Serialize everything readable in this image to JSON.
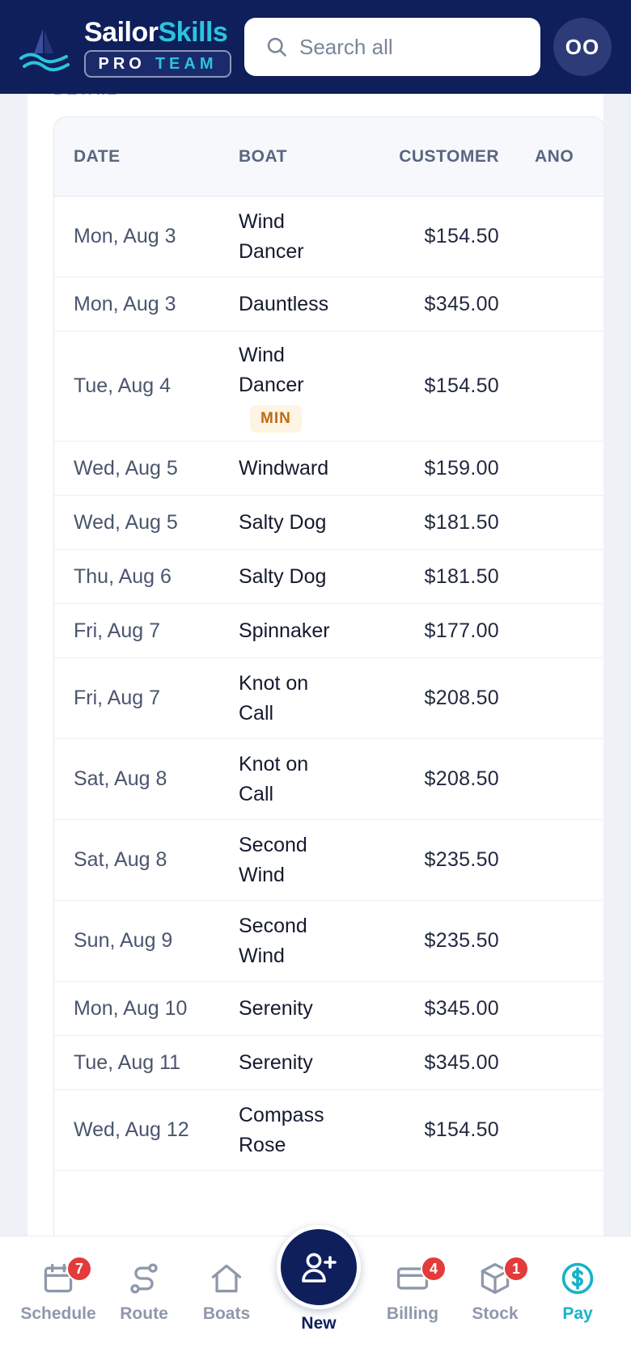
{
  "app": {
    "brand_primary": "Sailor",
    "brand_secondary": "Skills",
    "badge_primary": "PRO",
    "badge_secondary": "TEAM",
    "search_placeholder": "Search all",
    "avatar_initials": "OO"
  },
  "section": {
    "label": "DETAIL"
  },
  "table": {
    "columns": [
      "DATE",
      "BOAT",
      "CUSTOMER",
      "ANO"
    ],
    "rows": [
      {
        "date": "Mon, Aug 3",
        "boat_lines": [
          "Wind",
          "Dancer"
        ],
        "amount": "$154.50",
        "badge": ""
      },
      {
        "date": "Mon, Aug 3",
        "boat_lines": [
          "Dauntless"
        ],
        "amount": "$345.00",
        "badge": ""
      },
      {
        "date": "Tue, Aug 4",
        "boat_lines": [
          "Wind",
          "Dancer"
        ],
        "amount": "$154.50",
        "badge": "MIN"
      },
      {
        "date": "Wed, Aug 5",
        "boat_lines": [
          "Windward"
        ],
        "amount": "$159.00",
        "badge": ""
      },
      {
        "date": "Wed, Aug 5",
        "boat_lines": [
          "Salty Dog"
        ],
        "amount": "$181.50",
        "badge": ""
      },
      {
        "date": "Thu, Aug 6",
        "boat_lines": [
          "Salty Dog"
        ],
        "amount": "$181.50",
        "badge": ""
      },
      {
        "date": "Fri, Aug 7",
        "boat_lines": [
          "Spinnaker"
        ],
        "amount": "$177.00",
        "badge": ""
      },
      {
        "date": "Fri, Aug 7",
        "boat_lines": [
          "Knot on",
          "Call"
        ],
        "amount": "$208.50",
        "badge": ""
      },
      {
        "date": "Sat, Aug 8",
        "boat_lines": [
          "Knot on",
          "Call"
        ],
        "amount": "$208.50",
        "badge": ""
      },
      {
        "date": "Sat, Aug 8",
        "boat_lines": [
          "Second",
          "Wind"
        ],
        "amount": "$235.50",
        "badge": ""
      },
      {
        "date": "Sun, Aug 9",
        "boat_lines": [
          "Second",
          "Wind"
        ],
        "amount": "$235.50",
        "badge": ""
      },
      {
        "date": "Mon, Aug 10",
        "boat_lines": [
          "Serenity"
        ],
        "amount": "$345.00",
        "badge": ""
      },
      {
        "date": "Tue, Aug 11",
        "boat_lines": [
          "Serenity"
        ],
        "amount": "$345.00",
        "badge": ""
      },
      {
        "date": "Wed, Aug 12",
        "boat_lines": [
          "Compass",
          "Rose"
        ],
        "amount": "$154.50",
        "badge": ""
      }
    ]
  },
  "nav": {
    "items": [
      {
        "label": "Schedule",
        "icon": "calendar-icon",
        "badge": "7"
      },
      {
        "label": "Route",
        "icon": "route-icon",
        "badge": ""
      },
      {
        "label": "Boats",
        "icon": "home-icon",
        "badge": ""
      },
      {
        "label": "New",
        "icon": "add-user-icon",
        "badge": ""
      },
      {
        "label": "Billing",
        "icon": "credit-card-icon",
        "badge": "4"
      },
      {
        "label": "Stock",
        "icon": "box-icon",
        "badge": "1"
      },
      {
        "label": "Pay",
        "icon": "dollar-circle-icon",
        "badge": ""
      }
    ],
    "active": "Pay"
  },
  "colors": {
    "header_bg": "#0f1f5c",
    "accent": "#17b3c9",
    "badge_red": "#e33b3b",
    "min_badge_text": "#c06a14",
    "min_badge_bg": "#fdf4e3"
  }
}
